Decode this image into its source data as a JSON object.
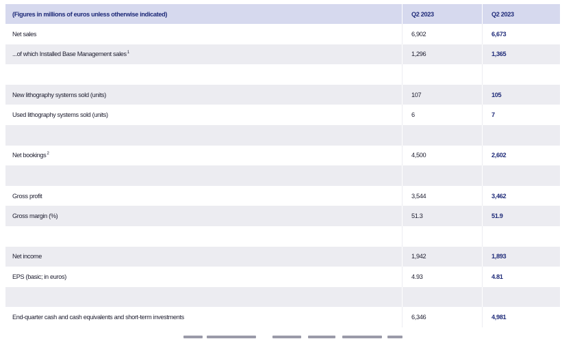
{
  "table": {
    "header": {
      "label": "(Figures in millions of euros unless otherwise indicated)",
      "col_prev": "Q2 2023",
      "col_curr": "Q2 2023"
    },
    "rows": [
      {
        "label": "Net sales",
        "sup": "",
        "prev": "6,902",
        "curr": "6,673"
      },
      {
        "label": "...of which Installed Base Management sales",
        "sup": "1",
        "prev": "1,296",
        "curr": "1,365"
      },
      {
        "label": "",
        "sup": "",
        "prev": "",
        "curr": ""
      },
      {
        "label": "New lithography systems sold (units)",
        "sup": "",
        "prev": "107",
        "curr": "105"
      },
      {
        "label": "Used lithography systems sold (units)",
        "sup": "",
        "prev": "6",
        "curr": "7"
      },
      {
        "label": "",
        "sup": "",
        "prev": "",
        "curr": ""
      },
      {
        "label": "Net bookings",
        "sup": "2",
        "prev": "4,500",
        "curr": "2,602"
      },
      {
        "label": "",
        "sup": "",
        "prev": "",
        "curr": ""
      },
      {
        "label": "Gross profit",
        "sup": "",
        "prev": "3,544",
        "curr": "3,462"
      },
      {
        "label": "Gross margin (%)",
        "sup": "",
        "prev": "51.3",
        "curr": "51.9"
      },
      {
        "label": "",
        "sup": "",
        "prev": "",
        "curr": ""
      },
      {
        "label": "Net income",
        "sup": "",
        "prev": "1,942",
        "curr": "1,893"
      },
      {
        "label": "EPS (basic; in euros)",
        "sup": "",
        "prev": "4.93",
        "curr": "4.81"
      },
      {
        "label": "",
        "sup": "",
        "prev": "",
        "curr": ""
      },
      {
        "label": "End-quarter cash and cash equivalents and short-term investments",
        "sup": "",
        "prev": "6,346",
        "curr": "4,981"
      }
    ]
  },
  "colors": {
    "header_bg": "#d6d9ee",
    "shade_bg": "#ececf1",
    "accent": "#1e2a78"
  }
}
